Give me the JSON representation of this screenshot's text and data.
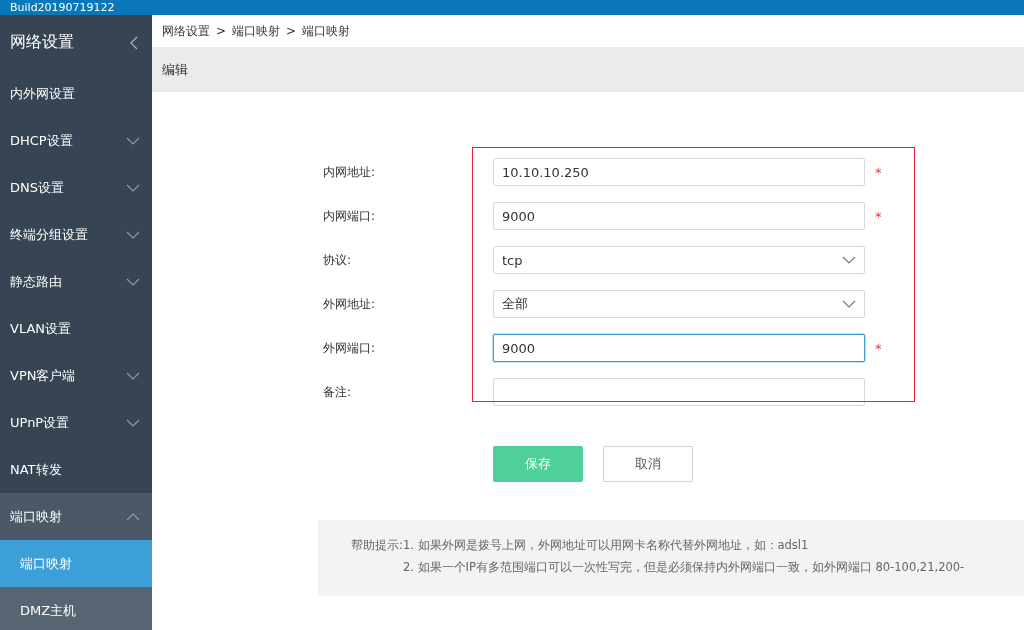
{
  "top_bar": {
    "title": "Build20190719122"
  },
  "sidebar": {
    "title": "网络设置",
    "items": [
      {
        "label": "内外网设置",
        "kind": "item",
        "selected": false
      },
      {
        "label": "DHCP设置",
        "kind": "group",
        "expanded": false
      },
      {
        "label": "DNS设置",
        "kind": "group",
        "expanded": false
      },
      {
        "label": "终端分组设置",
        "kind": "group",
        "expanded": false
      },
      {
        "label": "静态路由",
        "kind": "group",
        "expanded": false
      },
      {
        "label": "VLAN设置",
        "kind": "item",
        "selected": false
      },
      {
        "label": "VPN客户端",
        "kind": "group",
        "expanded": false
      },
      {
        "label": "UPnP设置",
        "kind": "group",
        "expanded": false
      },
      {
        "label": "NAT转发",
        "kind": "item",
        "selected": false
      },
      {
        "label": "端口映射",
        "kind": "group",
        "expanded": true,
        "children": [
          {
            "label": "端口映射",
            "selected": true
          },
          {
            "label": "DMZ主机",
            "selected": false
          }
        ]
      }
    ]
  },
  "breadcrumb": [
    "网络设置",
    "端口映射",
    "端口映射"
  ],
  "breadcrumb_separator": ">",
  "panel_title": "编辑",
  "form": [
    {
      "label": "内网地址:",
      "kind": "input",
      "value": "10.10.10.250",
      "required": true,
      "focused": false
    },
    {
      "label": "内网端口:",
      "kind": "input",
      "value": "9000",
      "required": true,
      "focused": false
    },
    {
      "label": "协议:",
      "kind": "select",
      "value": "tcp",
      "required": false
    },
    {
      "label": "外网地址:",
      "kind": "select",
      "value": "全部",
      "required": false
    },
    {
      "label": "外网端口:",
      "kind": "input",
      "value": "9000",
      "required": true,
      "focused": true
    },
    {
      "label": "备注:",
      "kind": "input",
      "required": false,
      "focused": false
    }
  ],
  "required_mark": "*",
  "buttons": [
    {
      "label": "保存",
      "kind": "primary"
    },
    {
      "label": "取消",
      "kind": "default"
    }
  ],
  "help": {
    "label": "帮助提示:",
    "lines": [
      "1. 如果外网是拨号上网，外网地址可以用网卡名称代替外网地址，如：adsl1",
      "2. 如果一个IP有多范围端口可以一次性写完，但是必须保持内外网端口一致，如外网端口 80-100,21,200-"
    ]
  }
}
